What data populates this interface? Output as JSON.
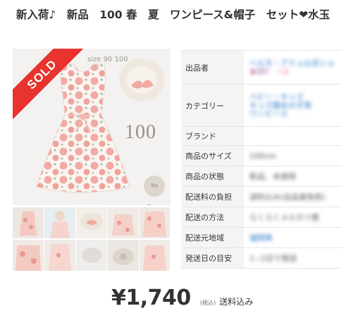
{
  "item": {
    "title": "新入荷♪　新品　100 春　夏　ワンピース&帽子　セット❤水玉",
    "sold_badge": "SOLD",
    "photo_size_text": "size 90 100",
    "photo_number": "100",
    "photo_brand_mark": "Sty Flower"
  },
  "details": {
    "rows": [
      {
        "label": "出品者",
        "value": "ハルモ・アミュ公式ショップ",
        "value2": "★5.0　☆2"
      },
      {
        "label": "カテゴリー",
        "value": "ベビー・キッズ",
        "value2": "キッズ服女の子用",
        "value3": "ワンピース"
      },
      {
        "label": "ブランド",
        "value": ""
      },
      {
        "label": "商品のサイズ",
        "value": "100cm"
      },
      {
        "label": "商品の状態",
        "value": "新品、未使用"
      },
      {
        "label": "配送料の負担",
        "value": "送料込み(出品者負担)"
      },
      {
        "label": "配送の方法",
        "value": "らくらくメルカリ便"
      },
      {
        "label": "配送元地域",
        "value": "福岡県"
      },
      {
        "label": "発送日の目安",
        "value": "1~2日で発送"
      }
    ]
  },
  "price": {
    "amount": "¥1,740",
    "tax_note": "(税込)",
    "shipping": "送料込み"
  },
  "colors": {
    "sold_ribbon": "#e8332e",
    "link_blue": "#1f74c8",
    "label_bg": "#f4f4f4",
    "dress_dot": "#f0a9a2"
  }
}
